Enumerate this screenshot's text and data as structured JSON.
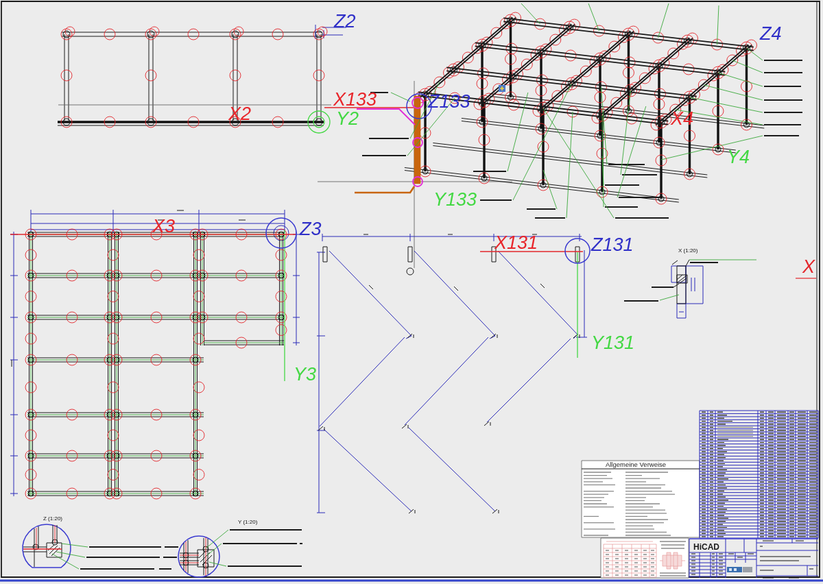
{
  "sheet": {
    "views": [
      {
        "kind": "elevation",
        "labels": [
          {
            "text": "Z2",
            "color": "#3030c8"
          },
          {
            "text": "X2",
            "color": "#e8262b"
          },
          {
            "text": "Y2",
            "color": "#44d844"
          }
        ]
      },
      {
        "kind": "isometric",
        "labels": [
          {
            "text": "X133",
            "color": "#e8262b"
          },
          {
            "text": "Z133",
            "color": "#3030c8"
          },
          {
            "text": "Y133",
            "color": "#44d844"
          },
          {
            "text": "Z4",
            "color": "#3030c8"
          },
          {
            "text": "X4",
            "color": "#e8262b"
          },
          {
            "text": "Y4",
            "color": "#44d844"
          }
        ]
      },
      {
        "kind": "plan",
        "labels": [
          {
            "text": "X3",
            "color": "#e8262b"
          },
          {
            "text": "Z3",
            "color": "#3030c8"
          },
          {
            "text": "Y3",
            "color": "#44d844"
          }
        ]
      },
      {
        "kind": "stringer",
        "labels": [
          {
            "text": "X131",
            "color": "#e8262b"
          },
          {
            "text": "Z131",
            "color": "#3030c8"
          },
          {
            "text": "Y131",
            "color": "#44d844"
          }
        ]
      }
    ],
    "details": [
      {
        "kind": "section",
        "title": "X (1:20)"
      },
      {
        "kind": "circle",
        "title": "Z (1:20)"
      },
      {
        "kind": "circle",
        "title": "Y (1:20)"
      }
    ],
    "section_mark": {
      "text": "X"
    },
    "notes": {
      "title": "Allgemeine Verweise"
    },
    "title_block": {
      "logo": "HiCAD"
    }
  }
}
